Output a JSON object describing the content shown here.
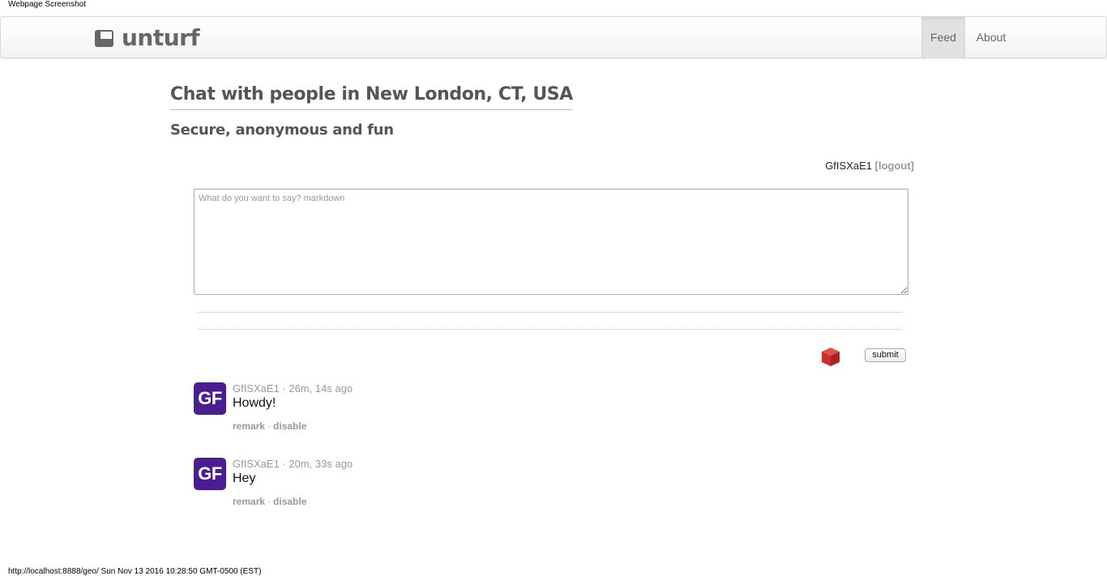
{
  "page": {
    "caption": "Webpage Screenshot",
    "footer": "http://localhost:8888/geo/ Sun Nov 13 2016 10:28:50 GMT-0500 (EST)"
  },
  "navbar": {
    "brand": "unturf",
    "links": [
      {
        "label": "Feed",
        "active": true
      },
      {
        "label": "About",
        "active": false
      }
    ]
  },
  "main": {
    "heading": "Chat with people in New London, CT, USA",
    "subheading": "Secure, anonymous and fun"
  },
  "user": {
    "name": "GfISXaE1",
    "logout_label": "[logout]"
  },
  "composer": {
    "placeholder": "What do you want to say? markdown",
    "value": "",
    "submit_label": "submit"
  },
  "posts": [
    {
      "avatar": "GF",
      "author": "GfISXaE1",
      "time": "26m, 14s ago",
      "body": "Howdy!",
      "actions": [
        "remark",
        "disable"
      ]
    },
    {
      "avatar": "GF",
      "author": "GfISXaE1",
      "time": "20m, 33s ago",
      "body": "Hey",
      "actions": [
        "remark",
        "disable"
      ]
    }
  ],
  "colors": {
    "avatar_bg": "#4a1d91",
    "captcha_cube": "#d0312d",
    "muted_text": "#999999"
  },
  "icons": {
    "brand": "window-icon",
    "captcha": "cube-icon"
  }
}
